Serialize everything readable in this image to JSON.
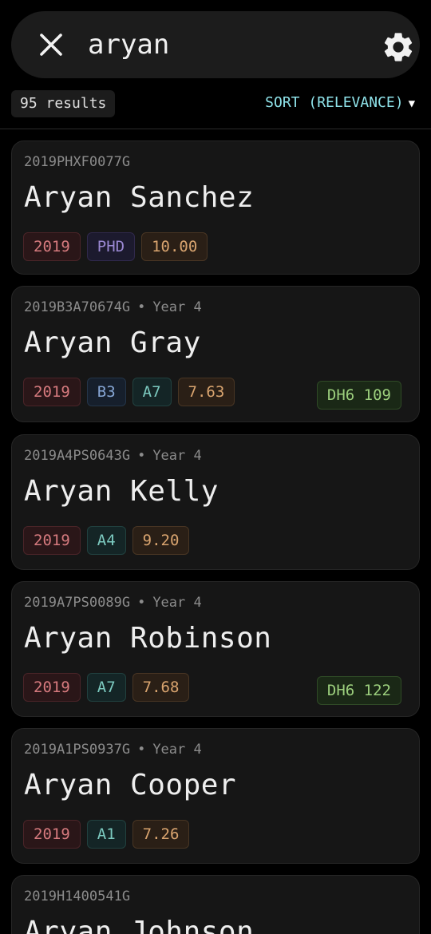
{
  "search": {
    "query": "aryan",
    "close_icon": "close-icon",
    "settings_icon": "gear-icon"
  },
  "results": {
    "count_label": "95 results",
    "sort_label": "SORT (RELEVANCE)",
    "sort_caret": "▼"
  },
  "colors": {
    "background": "#000000",
    "surface": "#1c1c1c",
    "card": "#161616",
    "accent": "#8fe3ea",
    "year_tag": "#d67a7e",
    "program_tag": "#9a88d2",
    "branch_tag": "#7ccac0",
    "branch_tag_alt": "#86a6d4",
    "cgpa_tag": "#d9a46f",
    "hostel_tag": "#9ccf7d"
  },
  "cards": [
    {
      "id": "2019PHXF0077G",
      "year_text": "",
      "name": "Aryan Sanchez",
      "tags": {
        "year": "2019",
        "program": "PHD",
        "cgpa": "10.00"
      }
    },
    {
      "id": "2019B3A70674G",
      "year_text": "Year 4",
      "name": "Aryan Gray",
      "tags": {
        "year": "2019",
        "branch1": "B3",
        "branch2": "A7",
        "cgpa": "7.63",
        "hostel": "DH6 109"
      }
    },
    {
      "id": "2019A4PS0643G",
      "year_text": "Year 4",
      "name": "Aryan Kelly",
      "tags": {
        "year": "2019",
        "branch1": "A4",
        "cgpa": "9.20"
      }
    },
    {
      "id": "2019A7PS0089G",
      "year_text": "Year 4",
      "name": "Aryan Robinson",
      "tags": {
        "year": "2019",
        "branch1": "A7",
        "cgpa": "7.68",
        "hostel": "DH6 122"
      }
    },
    {
      "id": "2019A1PS0937G",
      "year_text": "Year 4",
      "name": "Aryan Cooper",
      "tags": {
        "year": "2019",
        "branch1": "A1",
        "cgpa": "7.26"
      }
    },
    {
      "id": "2019H1400541G",
      "year_text": "",
      "name": "Aryan Johnson"
    }
  ]
}
